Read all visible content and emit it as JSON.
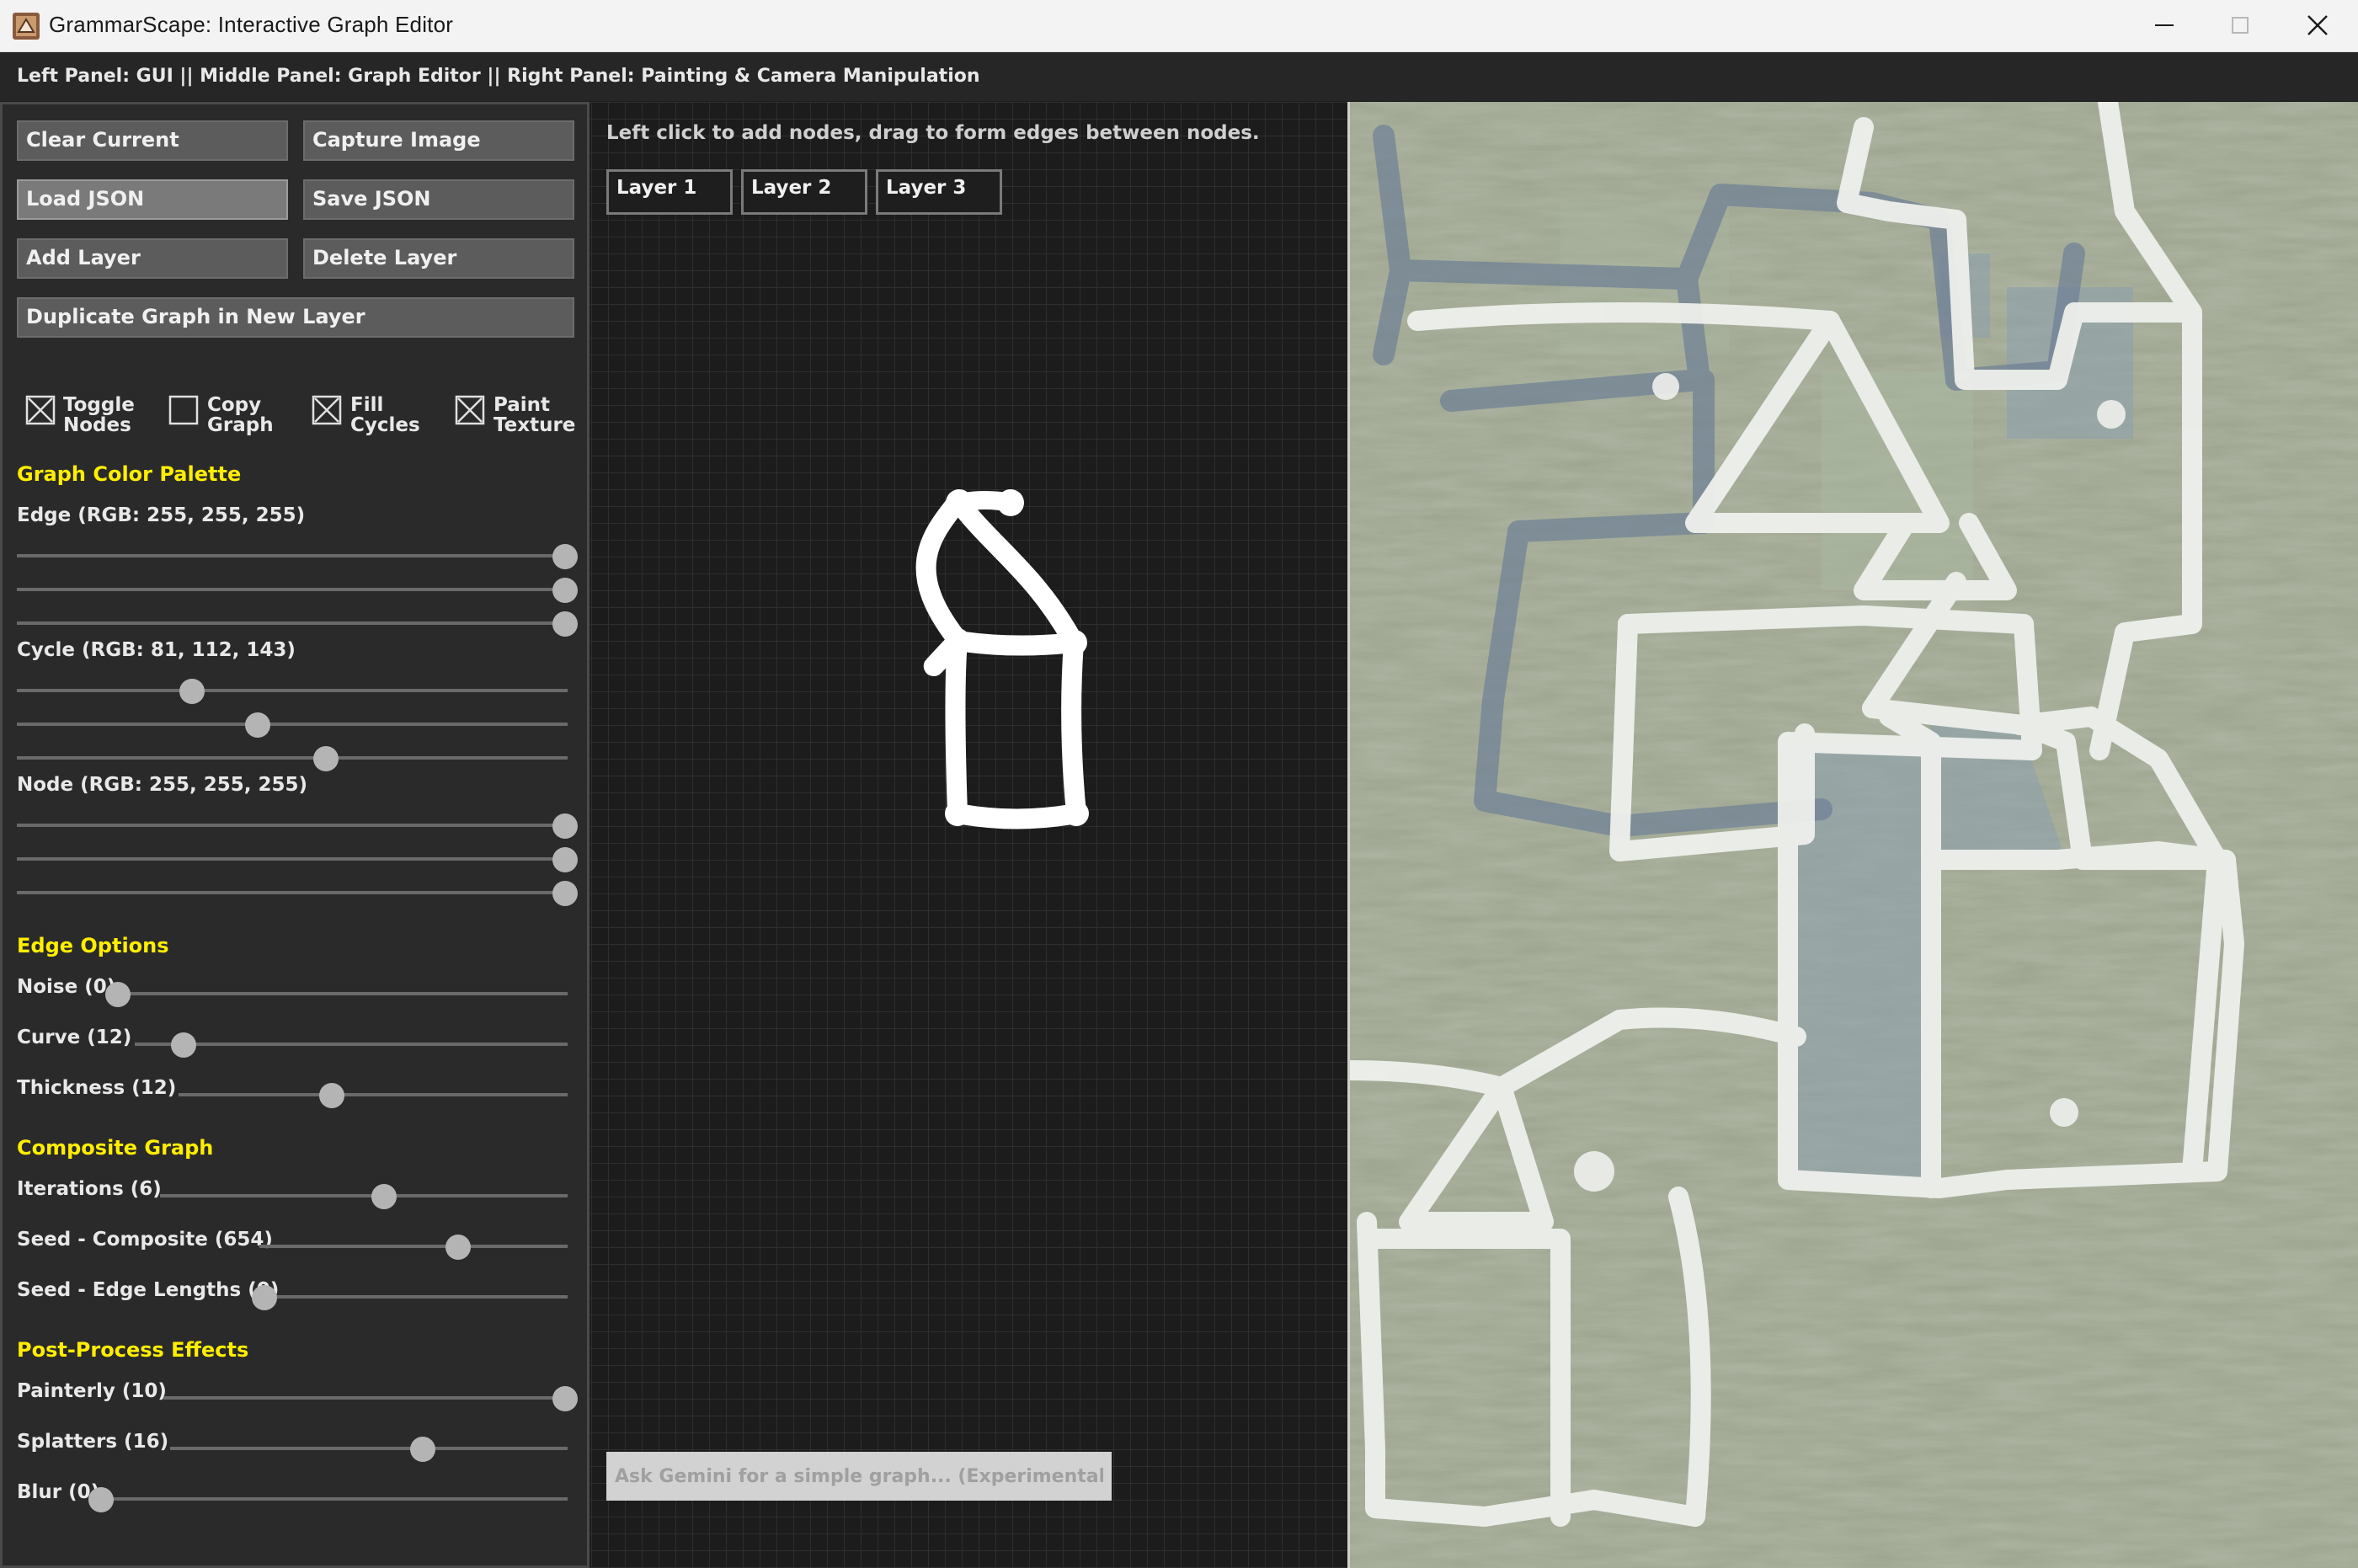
{
  "window": {
    "title": "GrammarScape: Interactive Graph Editor",
    "controls": [
      "minimize-icon",
      "maximize-icon",
      "close-icon"
    ]
  },
  "info_bar": {
    "text": "Left Panel: GUI || Middle Panel: Graph Editor || Right Panel: Painting & Camera Manipulation"
  },
  "left_panel": {
    "buttons": {
      "clear_current": "Clear Current",
      "capture_image": "Capture Image",
      "load_json": "Load JSON",
      "save_json": "Save JSON",
      "add_layer": "Add Layer",
      "delete_layer": "Delete Layer",
      "duplicate_graph": "Duplicate Graph in New Layer"
    },
    "checkboxes": [
      {
        "line1": "Toggle",
        "line2": "Nodes",
        "checked": true
      },
      {
        "line1": "Copy",
        "line2": "Graph",
        "checked": false
      },
      {
        "line1": "Fill",
        "line2": "Cycles",
        "checked": true
      },
      {
        "line1": "Paint",
        "line2": "Texture",
        "checked": true
      }
    ],
    "palette": {
      "heading": "Graph Color Palette",
      "edge_label": "Edge (RGB: 255, 255, 255)",
      "edge_rgb": [
        255,
        255,
        255
      ],
      "cycle_label": "Cycle (RGB: 81, 112, 143)",
      "cycle_rgb": [
        81,
        112,
        143
      ],
      "node_label": "Node (RGB: 255, 255, 255)",
      "node_rgb": [
        255,
        255,
        255
      ]
    },
    "edge_options": {
      "heading": "Edge Options",
      "noise_label": "Noise (0)",
      "noise": 0,
      "curve_label": "Curve (12)",
      "curve": 12,
      "thickness_label": "Thickness (12)",
      "thickness": 12
    },
    "composite": {
      "heading": "Composite Graph",
      "iterations_label": "Iterations (6)",
      "iterations": 6,
      "seed_composite_label": "Seed - Composite (654)",
      "seed_composite": 654,
      "seed_edge_label": "Seed - Edge Lengths (0)",
      "seed_edge": 0
    },
    "post": {
      "heading": "Post-Process Effects",
      "painterly_label": "Painterly (10)",
      "painterly": 10,
      "splatters_label": "Splatters (16)",
      "splatters": 16,
      "blur_label": "Blur (0)",
      "blur": 0
    }
  },
  "middle_panel": {
    "hint": "Left click to add nodes, drag to form edges between nodes.",
    "layers": [
      "Layer 1",
      "Layer 2",
      "Layer 3"
    ],
    "gemini_placeholder": "Ask Gemini for a simple graph... (Experimental)"
  },
  "colors": {
    "section_heading": "#ffee00",
    "edge": "#ffffff",
    "cycle": "#51708f",
    "node": "#ffffff",
    "canvas_bg": "#9aa28e"
  }
}
